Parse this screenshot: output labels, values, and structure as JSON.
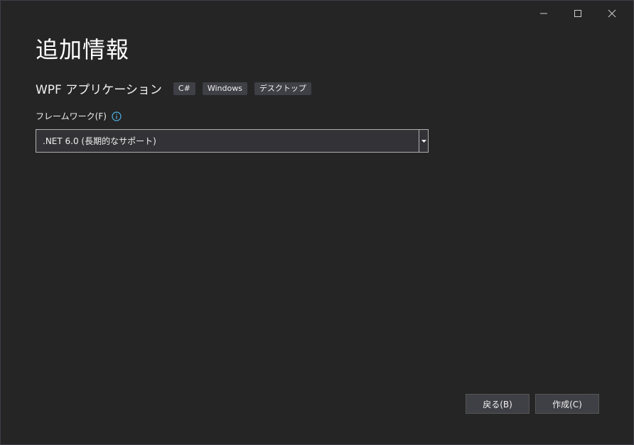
{
  "window": {
    "controls": [
      {
        "name": "minimize",
        "icon": "minimize-icon"
      },
      {
        "name": "maximize",
        "icon": "maximize-icon"
      },
      {
        "name": "close",
        "icon": "close-icon"
      }
    ]
  },
  "page": {
    "title": "追加情報",
    "subtitle": "WPF アプリケーション",
    "tags": [
      "C#",
      "Windows",
      "デスクトップ"
    ]
  },
  "framework": {
    "label": "フレームワーク(F)",
    "info_icon": "info-icon",
    "selected": ".NET 6.0 (長期的なサポート)"
  },
  "buttons": {
    "back_label": "戻る(B)",
    "create_label": "作成(C)"
  },
  "colors": {
    "background": "#252526",
    "tag_background": "#3f3f46",
    "info_accent": "#4fb3e8"
  }
}
